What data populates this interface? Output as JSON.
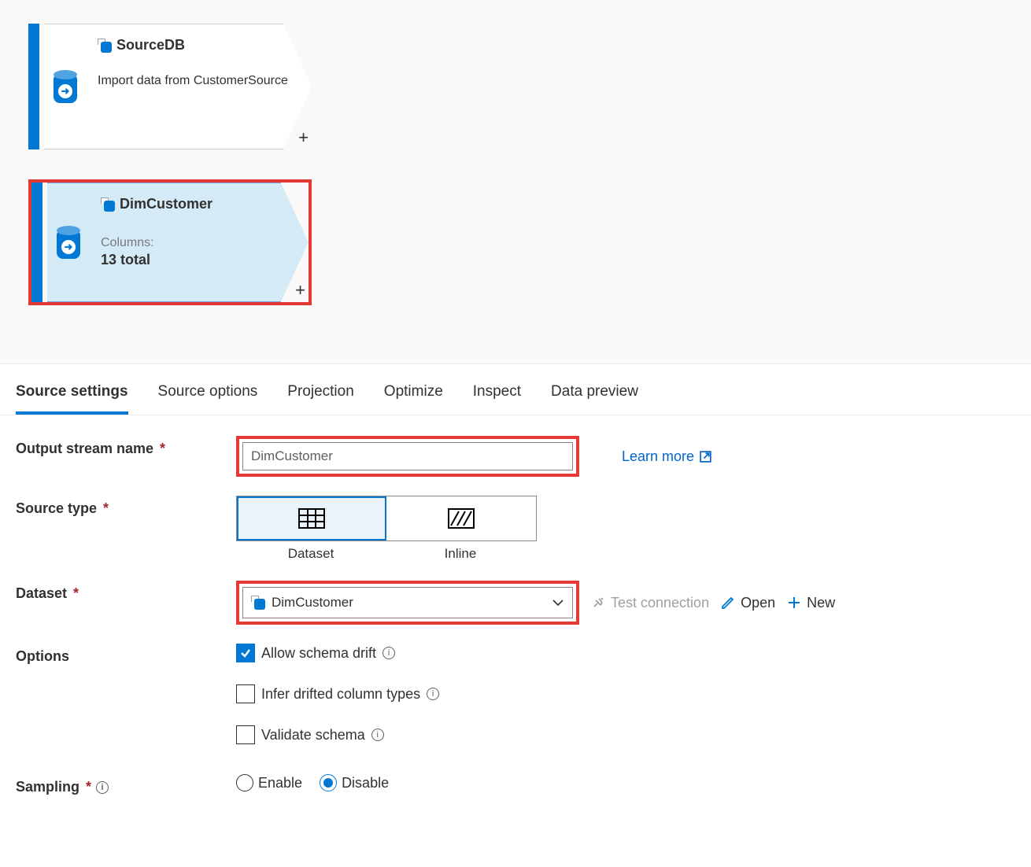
{
  "nodes": {
    "source1": {
      "title": "SourceDB",
      "desc": "Import data from CustomerSource"
    },
    "source2": {
      "title": "DimCustomer",
      "columns_label": "Columns:",
      "columns_total": "13 total"
    }
  },
  "tabs": {
    "source_settings": "Source settings",
    "source_options": "Source options",
    "projection": "Projection",
    "optimize": "Optimize",
    "inspect": "Inspect",
    "data_preview": "Data preview"
  },
  "form": {
    "output_label": "Output stream name",
    "output_value": "DimCustomer",
    "learn_more": "Learn more",
    "source_type_label": "Source type",
    "source_type_dataset": "Dataset",
    "source_type_inline": "Inline",
    "dataset_label": "Dataset",
    "dataset_value": "DimCustomer",
    "test_connection": "Test connection",
    "open": "Open",
    "new": "New",
    "options_label": "Options",
    "opt_allow": "Allow schema drift",
    "opt_infer": "Infer drifted column types",
    "opt_validate": "Validate schema",
    "sampling_label": "Sampling",
    "sampling_enable": "Enable",
    "sampling_disable": "Disable"
  }
}
